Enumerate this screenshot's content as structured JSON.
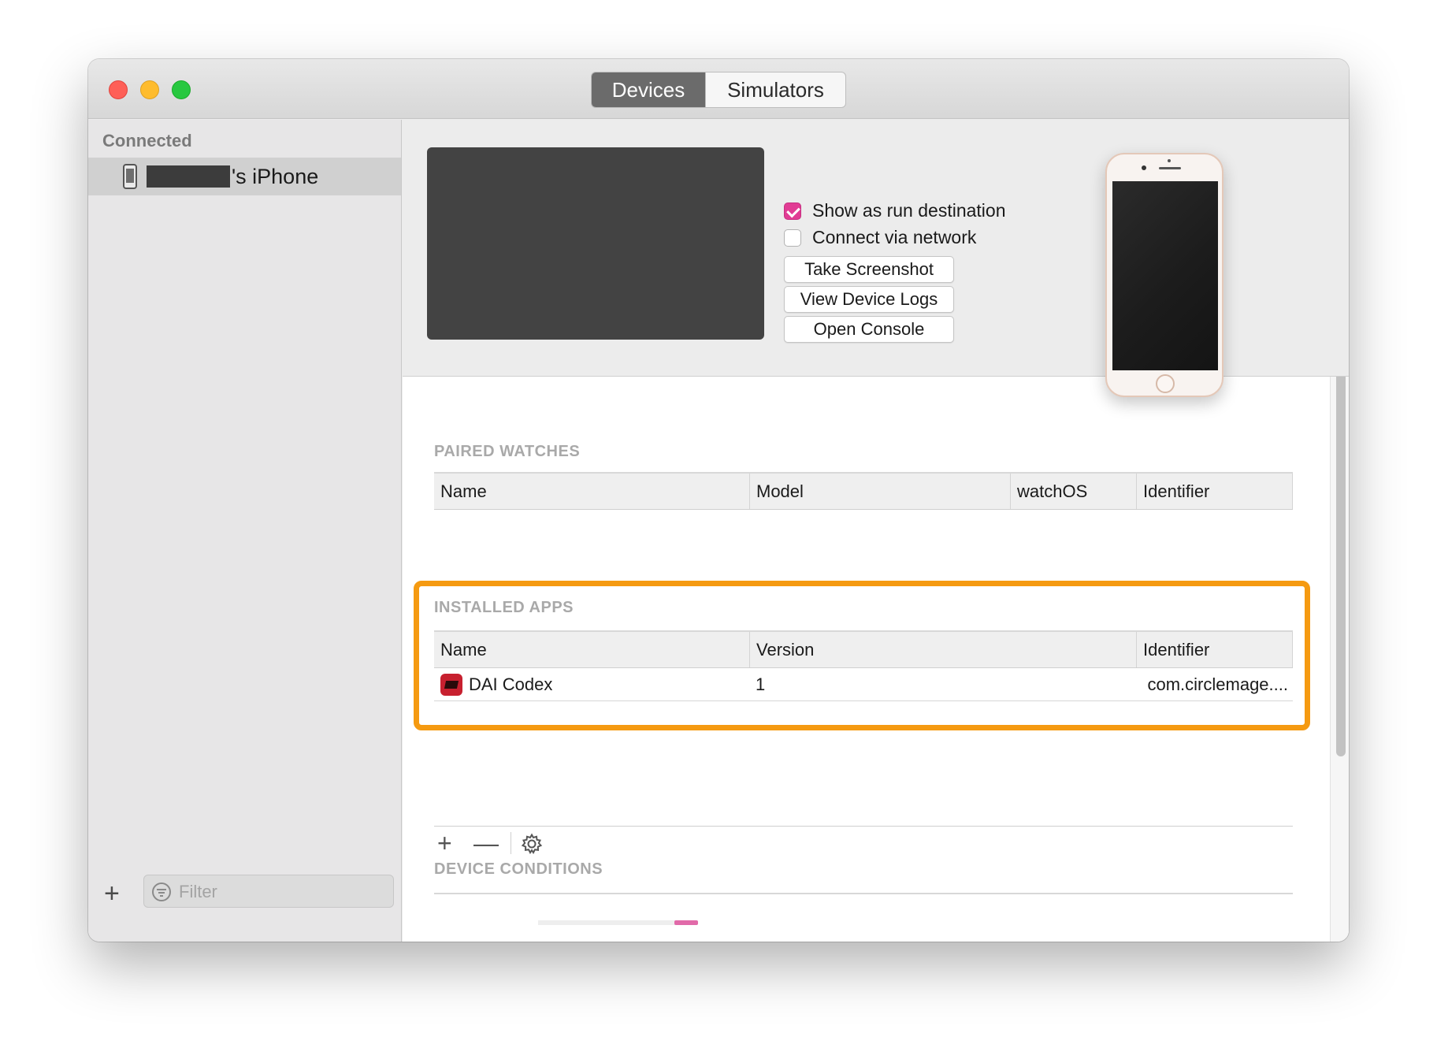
{
  "window": {
    "tabs": [
      {
        "label": "Devices",
        "selected": true
      },
      {
        "label": "Simulators",
        "selected": false
      }
    ]
  },
  "sidebar": {
    "heading": "Connected",
    "device": {
      "name": "'s iPhone",
      "icon": "iphone-icon"
    },
    "add_icon": "+",
    "filter": {
      "placeholder": "Filter",
      "icon": "filter-icon"
    }
  },
  "device_panel": {
    "show_run_destination": {
      "label": "Show as run destination",
      "checked": true
    },
    "connect_network": {
      "label": "Connect via network",
      "checked": false
    },
    "buttons": [
      "Take Screenshot",
      "View Device Logs",
      "Open Console"
    ]
  },
  "paired_watches": {
    "title": "PAIRED WATCHES",
    "columns": [
      "Name",
      "Model",
      "watchOS",
      "Identifier"
    ],
    "rows": []
  },
  "installed_apps": {
    "title": "INSTALLED APPS",
    "columns": [
      "Name",
      "Version",
      "Identifier"
    ],
    "rows": [
      {
        "name": "DAI Codex",
        "version": "1",
        "identifier": "com.circlemage...."
      }
    ]
  },
  "app_toolbar": {
    "add": "+",
    "remove": "—",
    "settings_icon": "gear-icon"
  },
  "device_conditions": {
    "title": "DEVICE CONDITIONS"
  },
  "colors": {
    "accent": "#e13c94",
    "highlight": "#f59a11",
    "selected_tab": "#6b6b6b"
  }
}
